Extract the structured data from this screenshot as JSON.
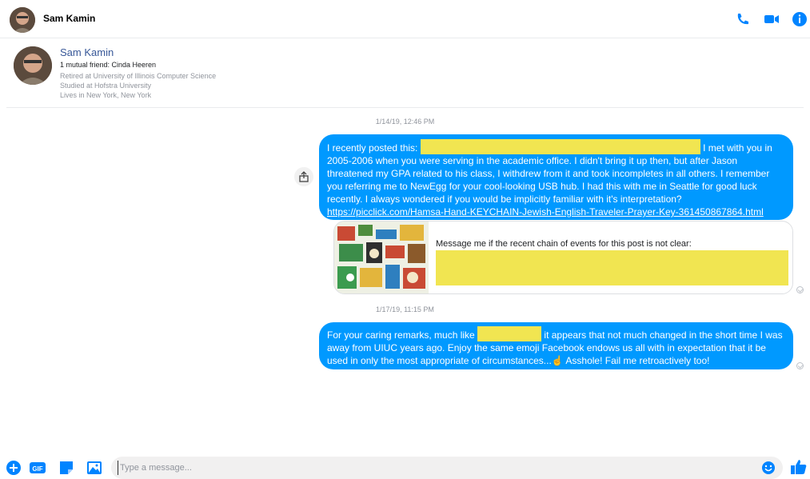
{
  "header": {
    "name": "Sam Kamin"
  },
  "profile": {
    "name": "Sam Kamin",
    "mutual": "1 mutual friend: Cinda Heeren",
    "lines": [
      "Retired at University of Illinois Computer Science",
      "Studied at Hofstra University",
      "Lives in New York, New York"
    ]
  },
  "conversation": {
    "ts1": "1/14/19, 12:46 PM",
    "msg1": {
      "prefix": "I recently posted this:",
      "line1_tail": "I met with you in",
      "body": "2005-2006 when you were serving in the academic office. I didn't bring it up then, but after Jason threatened my GPA related to his class, I withdrew from it and took incompletes in all others. I remember you referring me to NewEgg for your cool-looking USB hub. I had this with me in Seattle for good luck recently. I always wondered if you would be implicitly familiar with it's interpretation?",
      "link": "https://picclick.com/Hamsa-Hand-KEYCHAIN-Jewish-English-Traveler-Prayer-Key-361450867864.html"
    },
    "card": {
      "text": "Message me if the recent chain of events for this post is not clear:"
    },
    "ts2": "1/17/19, 11:15 PM",
    "msg2": {
      "prefix": "For your caring remarks, much like",
      "line1_tail": "it appears that not much changed in the short time I was",
      "body": "away from UIUC years ago. Enjoy the same emoji Facebook endows us all with in expectation that it be used in only the most appropriate of circumstances...☝️ Asshole! Fail me retroactively too!"
    }
  },
  "composer": {
    "placeholder": "Type a message...",
    "gif_label": "GIF"
  },
  "colors": {
    "accent": "#0099ff",
    "redaction": "#f1e551",
    "link": "#385898"
  }
}
